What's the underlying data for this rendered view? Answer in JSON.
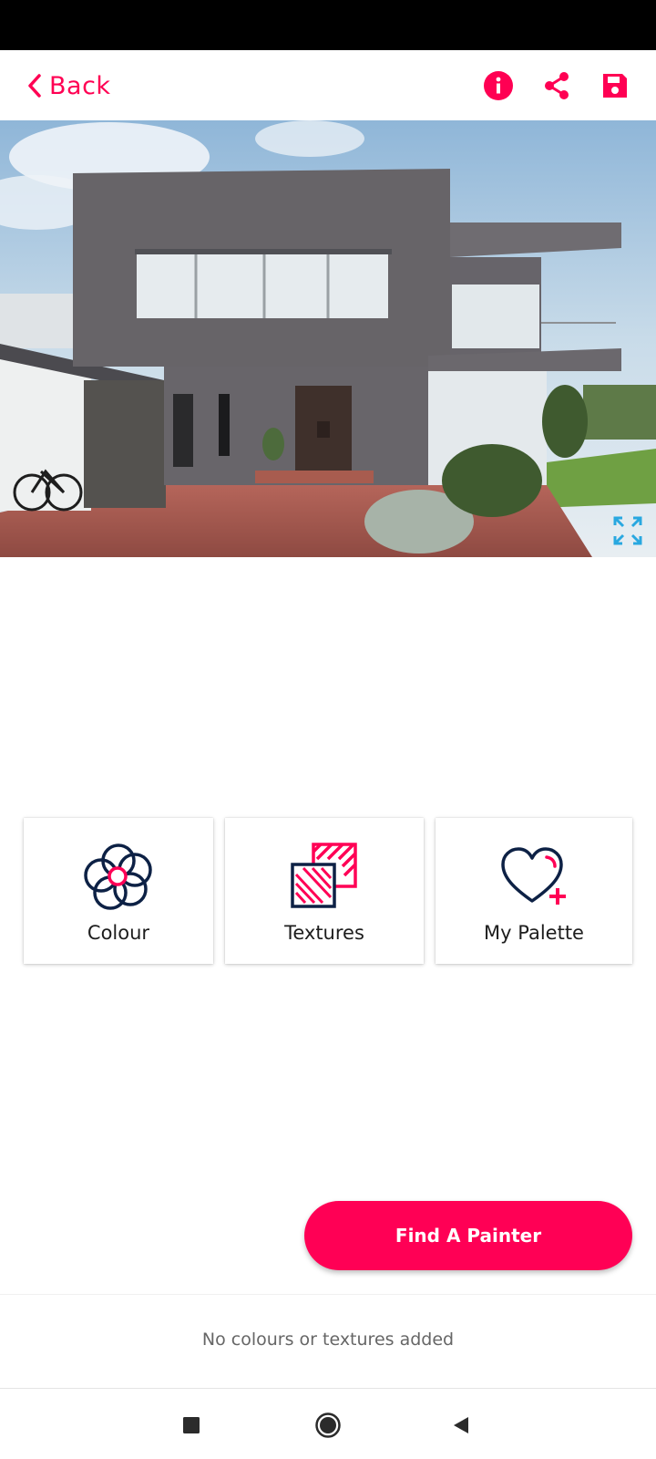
{
  "header": {
    "back_label": "Back",
    "icons": [
      "info-icon",
      "share-icon",
      "save-icon"
    ]
  },
  "tools": [
    {
      "label": "Colour",
      "icon": "colour-wheel-icon"
    },
    {
      "label": "Textures",
      "icon": "textures-icon"
    },
    {
      "label": "My Palette",
      "icon": "heart-plus-icon"
    }
  ],
  "find_painter_label": "Find A Painter",
  "empty_message": "No colours or textures added",
  "colors": {
    "accent": "#ff0055",
    "navy": "#0d2145",
    "wall": "#676468",
    "expand_icon": "#29a8e0"
  }
}
